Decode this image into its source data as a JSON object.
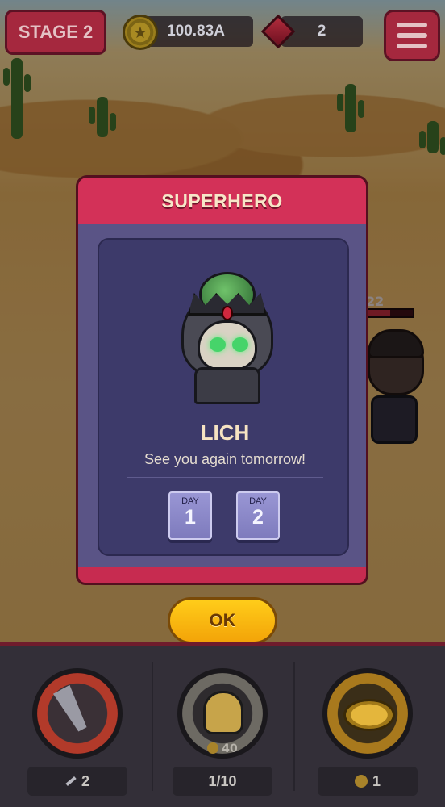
{
  "top_bar": {
    "stage_label": "STAGE 2",
    "gold_amount": "100.83A",
    "gem_amount": "2"
  },
  "enemy": {
    "level_label": "22",
    "hp_fraction": 0.5
  },
  "popup": {
    "title": "SUPERHERO",
    "hero_name": "LICH",
    "message": "See you again tomorrow!",
    "days": [
      {
        "label": "DAY",
        "number": "1"
      },
      {
        "label": "DAY",
        "number": "2"
      }
    ],
    "ok_label": "OK"
  },
  "bottom_bar": {
    "slots": [
      {
        "name": "weapon",
        "label": "2",
        "icon": "sword-icon"
      },
      {
        "name": "hero",
        "cost": "40",
        "label": "1/10",
        "icon": "hero-portrait-icon"
      },
      {
        "name": "gold",
        "label": "1",
        "icon": "coin-stack-icon"
      }
    ]
  },
  "colors": {
    "popup_header": "#d33158",
    "popup_body": "#5a5486",
    "ok_button": "#ffcd1a",
    "stage_button": "#a5283e"
  }
}
